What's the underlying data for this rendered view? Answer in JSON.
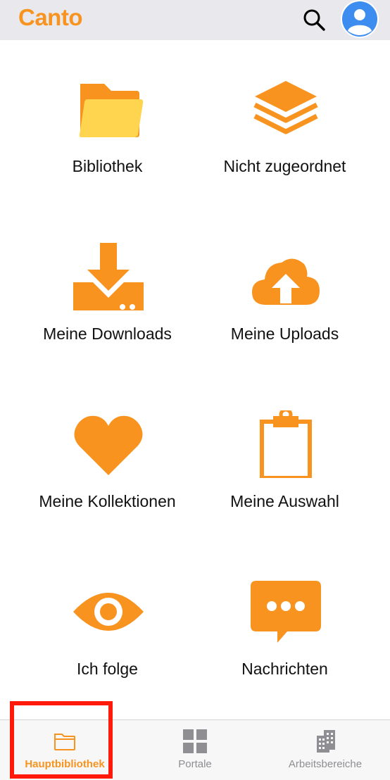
{
  "app": {
    "brand": "Canto"
  },
  "colors": {
    "accent": "#f7931e",
    "accent_light": "#ffd54f",
    "highlight": "#ff1a0a"
  },
  "header": {
    "search_icon": "search-icon",
    "avatar_icon": "user-avatar-icon"
  },
  "tiles": [
    {
      "label": "Bibliothek",
      "icon": "folder-icon"
    },
    {
      "label": "Nicht zugeordnet",
      "icon": "layers-icon"
    },
    {
      "label": "Meine Downloads",
      "icon": "download-icon"
    },
    {
      "label": "Meine Uploads",
      "icon": "cloud-upload-icon"
    },
    {
      "label": "Meine Kollektionen",
      "icon": "heart-icon"
    },
    {
      "label": "Meine Auswahl",
      "icon": "clipboard-icon"
    },
    {
      "label": "Ich folge",
      "icon": "eye-icon"
    },
    {
      "label": "Nachrichten",
      "icon": "message-icon"
    }
  ],
  "tabbar": {
    "active": "Hauptbibliothek",
    "tabs": [
      {
        "label": "Hauptbibliothek",
        "icon": "folder-outline-icon"
      },
      {
        "label": "Portale",
        "icon": "grid-icon"
      },
      {
        "label": "Arbeitsbereiche",
        "icon": "buildings-icon"
      }
    ]
  }
}
